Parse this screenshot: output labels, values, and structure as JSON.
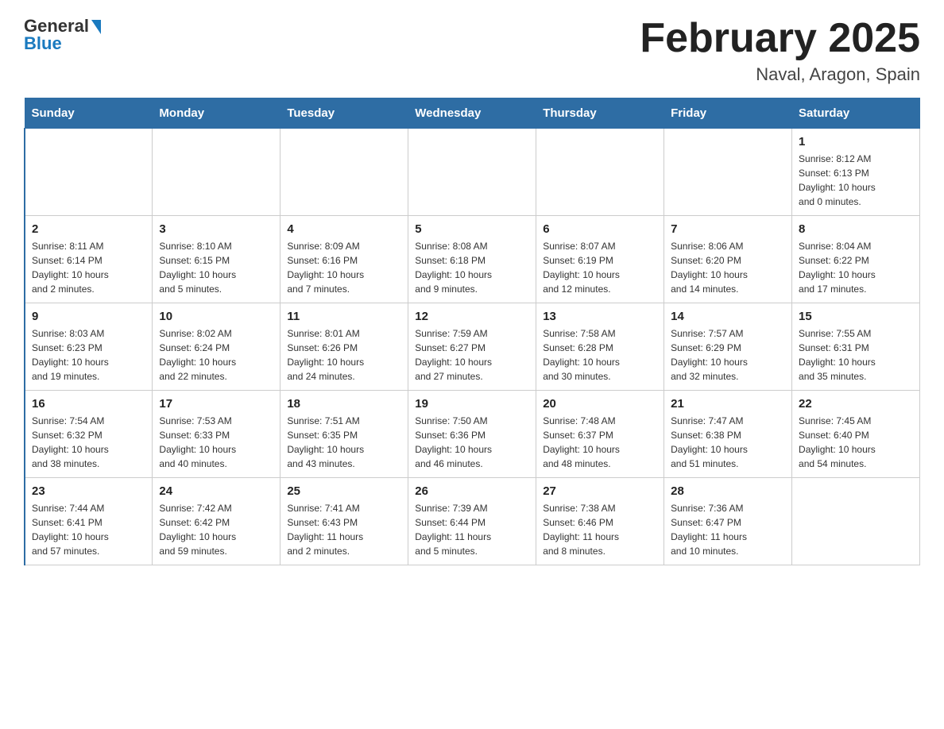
{
  "header": {
    "logo": {
      "general": "General",
      "blue": "Blue"
    },
    "title": "February 2025",
    "location": "Naval, Aragon, Spain"
  },
  "weekdays": [
    "Sunday",
    "Monday",
    "Tuesday",
    "Wednesday",
    "Thursday",
    "Friday",
    "Saturday"
  ],
  "weeks": [
    [
      {
        "day": "",
        "info": ""
      },
      {
        "day": "",
        "info": ""
      },
      {
        "day": "",
        "info": ""
      },
      {
        "day": "",
        "info": ""
      },
      {
        "day": "",
        "info": ""
      },
      {
        "day": "",
        "info": ""
      },
      {
        "day": "1",
        "info": "Sunrise: 8:12 AM\nSunset: 6:13 PM\nDaylight: 10 hours\nand 0 minutes."
      }
    ],
    [
      {
        "day": "2",
        "info": "Sunrise: 8:11 AM\nSunset: 6:14 PM\nDaylight: 10 hours\nand 2 minutes."
      },
      {
        "day": "3",
        "info": "Sunrise: 8:10 AM\nSunset: 6:15 PM\nDaylight: 10 hours\nand 5 minutes."
      },
      {
        "day": "4",
        "info": "Sunrise: 8:09 AM\nSunset: 6:16 PM\nDaylight: 10 hours\nand 7 minutes."
      },
      {
        "day": "5",
        "info": "Sunrise: 8:08 AM\nSunset: 6:18 PM\nDaylight: 10 hours\nand 9 minutes."
      },
      {
        "day": "6",
        "info": "Sunrise: 8:07 AM\nSunset: 6:19 PM\nDaylight: 10 hours\nand 12 minutes."
      },
      {
        "day": "7",
        "info": "Sunrise: 8:06 AM\nSunset: 6:20 PM\nDaylight: 10 hours\nand 14 minutes."
      },
      {
        "day": "8",
        "info": "Sunrise: 8:04 AM\nSunset: 6:22 PM\nDaylight: 10 hours\nand 17 minutes."
      }
    ],
    [
      {
        "day": "9",
        "info": "Sunrise: 8:03 AM\nSunset: 6:23 PM\nDaylight: 10 hours\nand 19 minutes."
      },
      {
        "day": "10",
        "info": "Sunrise: 8:02 AM\nSunset: 6:24 PM\nDaylight: 10 hours\nand 22 minutes."
      },
      {
        "day": "11",
        "info": "Sunrise: 8:01 AM\nSunset: 6:26 PM\nDaylight: 10 hours\nand 24 minutes."
      },
      {
        "day": "12",
        "info": "Sunrise: 7:59 AM\nSunset: 6:27 PM\nDaylight: 10 hours\nand 27 minutes."
      },
      {
        "day": "13",
        "info": "Sunrise: 7:58 AM\nSunset: 6:28 PM\nDaylight: 10 hours\nand 30 minutes."
      },
      {
        "day": "14",
        "info": "Sunrise: 7:57 AM\nSunset: 6:29 PM\nDaylight: 10 hours\nand 32 minutes."
      },
      {
        "day": "15",
        "info": "Sunrise: 7:55 AM\nSunset: 6:31 PM\nDaylight: 10 hours\nand 35 minutes."
      }
    ],
    [
      {
        "day": "16",
        "info": "Sunrise: 7:54 AM\nSunset: 6:32 PM\nDaylight: 10 hours\nand 38 minutes."
      },
      {
        "day": "17",
        "info": "Sunrise: 7:53 AM\nSunset: 6:33 PM\nDaylight: 10 hours\nand 40 minutes."
      },
      {
        "day": "18",
        "info": "Sunrise: 7:51 AM\nSunset: 6:35 PM\nDaylight: 10 hours\nand 43 minutes."
      },
      {
        "day": "19",
        "info": "Sunrise: 7:50 AM\nSunset: 6:36 PM\nDaylight: 10 hours\nand 46 minutes."
      },
      {
        "day": "20",
        "info": "Sunrise: 7:48 AM\nSunset: 6:37 PM\nDaylight: 10 hours\nand 48 minutes."
      },
      {
        "day": "21",
        "info": "Sunrise: 7:47 AM\nSunset: 6:38 PM\nDaylight: 10 hours\nand 51 minutes."
      },
      {
        "day": "22",
        "info": "Sunrise: 7:45 AM\nSunset: 6:40 PM\nDaylight: 10 hours\nand 54 minutes."
      }
    ],
    [
      {
        "day": "23",
        "info": "Sunrise: 7:44 AM\nSunset: 6:41 PM\nDaylight: 10 hours\nand 57 minutes."
      },
      {
        "day": "24",
        "info": "Sunrise: 7:42 AM\nSunset: 6:42 PM\nDaylight: 10 hours\nand 59 minutes."
      },
      {
        "day": "25",
        "info": "Sunrise: 7:41 AM\nSunset: 6:43 PM\nDaylight: 11 hours\nand 2 minutes."
      },
      {
        "day": "26",
        "info": "Sunrise: 7:39 AM\nSunset: 6:44 PM\nDaylight: 11 hours\nand 5 minutes."
      },
      {
        "day": "27",
        "info": "Sunrise: 7:38 AM\nSunset: 6:46 PM\nDaylight: 11 hours\nand 8 minutes."
      },
      {
        "day": "28",
        "info": "Sunrise: 7:36 AM\nSunset: 6:47 PM\nDaylight: 11 hours\nand 10 minutes."
      },
      {
        "day": "",
        "info": ""
      }
    ]
  ]
}
